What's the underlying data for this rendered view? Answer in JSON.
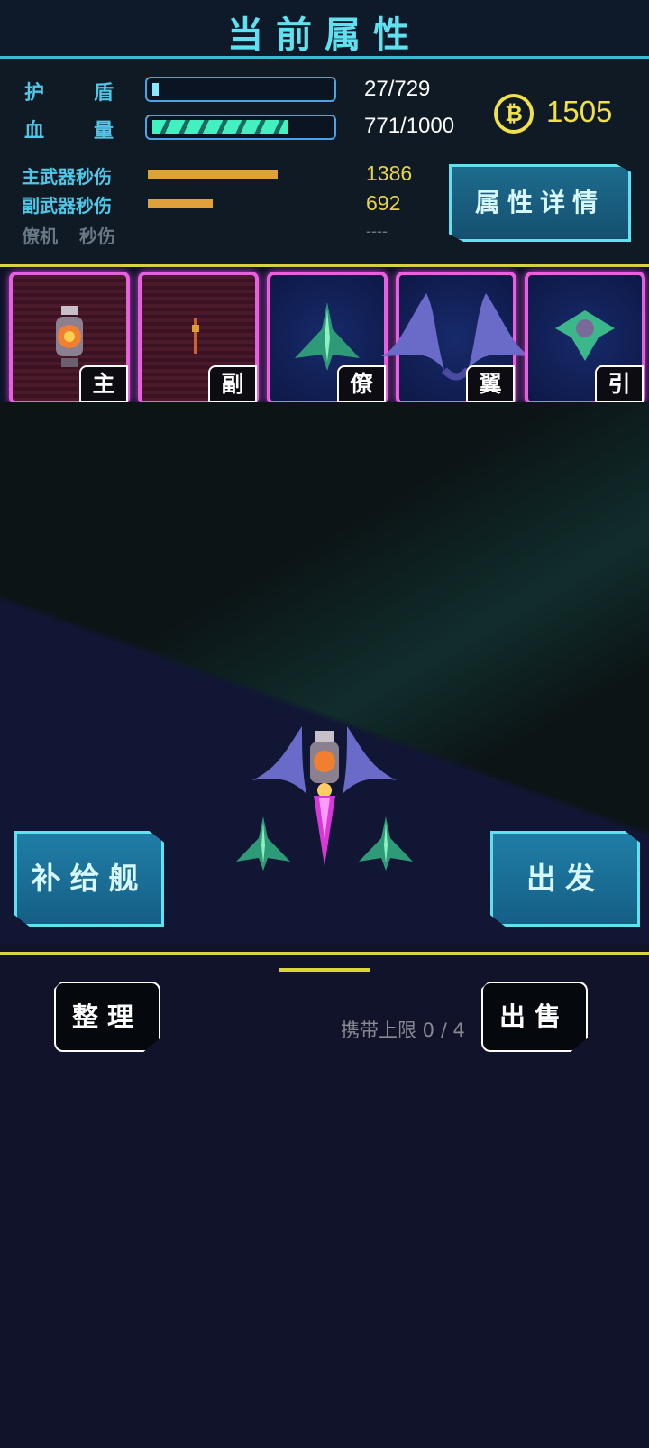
{
  "header": {
    "title": "当前属性"
  },
  "stats": {
    "shield": {
      "label_a": "护",
      "label_b": "盾",
      "value": "27/729",
      "ratio": 0.037
    },
    "hp": {
      "label_a": "血",
      "label_b": "量",
      "value": "771/1000",
      "ratio": 0.771
    },
    "main_dps": {
      "label": "主武器秒伤",
      "value": "1386"
    },
    "sub_dps": {
      "label": "副武器秒伤",
      "value": "692"
    },
    "wingman_dps": {
      "label_a": "僚机",
      "label_b": "秒伤",
      "value": "----"
    }
  },
  "currency": {
    "icon": "coin-icon",
    "glyph": "₿",
    "value": "1505"
  },
  "detail_button": {
    "label": "属性详情"
  },
  "slots": [
    {
      "tag": "主",
      "icon": "main-weapon-icon"
    },
    {
      "tag": "副",
      "icon": "sub-weapon-icon"
    },
    {
      "tag": "僚",
      "icon": "wingman-icon"
    },
    {
      "tag": "翼",
      "icon": "wing-icon"
    },
    {
      "tag": "引",
      "icon": "engine-icon"
    }
  ],
  "actions": {
    "supply_ship": "补给舰",
    "depart": "出发",
    "organize": "整理",
    "sell": "出售",
    "capacity": "携带上限 0 / 4"
  },
  "colors": {
    "accent": "#5fe1f0",
    "gold": "#f0e04a",
    "slot_border": "#e860e0"
  }
}
